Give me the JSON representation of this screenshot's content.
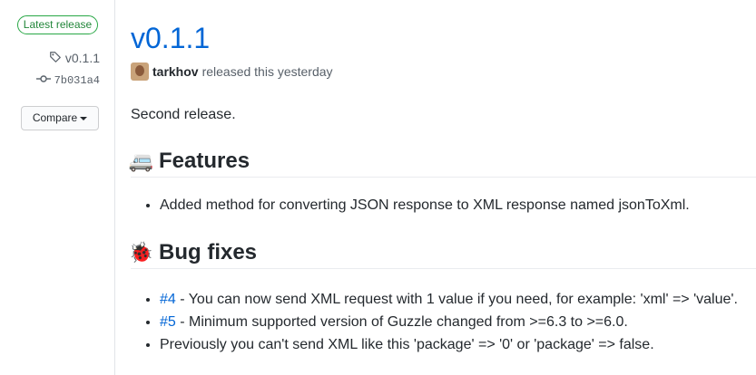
{
  "sidebar": {
    "badge": "Latest release",
    "tag": "v0.1.1",
    "commit": "7b031a4",
    "compare": "Compare"
  },
  "release": {
    "title": "v0.1.1",
    "author": "tarkhov",
    "released_text": "released this yesterday",
    "intro": "Second release.",
    "features_heading": "Features",
    "features_emoji": "🚐",
    "features": [
      "Added method for converting JSON response to XML response named jsonToXml."
    ],
    "bugs_heading": "Bug fixes",
    "bugs_emoji": "🐞",
    "bugs": [
      {
        "link": "#4",
        "text": " - You can now send XML request with 1 value if you need, for example: 'xml' => 'value'."
      },
      {
        "link": "#5",
        "text": " - Minimum supported version of Guzzle changed from >=6.3 to >=6.0."
      },
      {
        "link": "",
        "text": "Previously you can't send XML like this 'package' => '0' or 'package' => false."
      }
    ]
  },
  "colors": {
    "link": "#0366d6",
    "badge_green": "#28a745"
  }
}
